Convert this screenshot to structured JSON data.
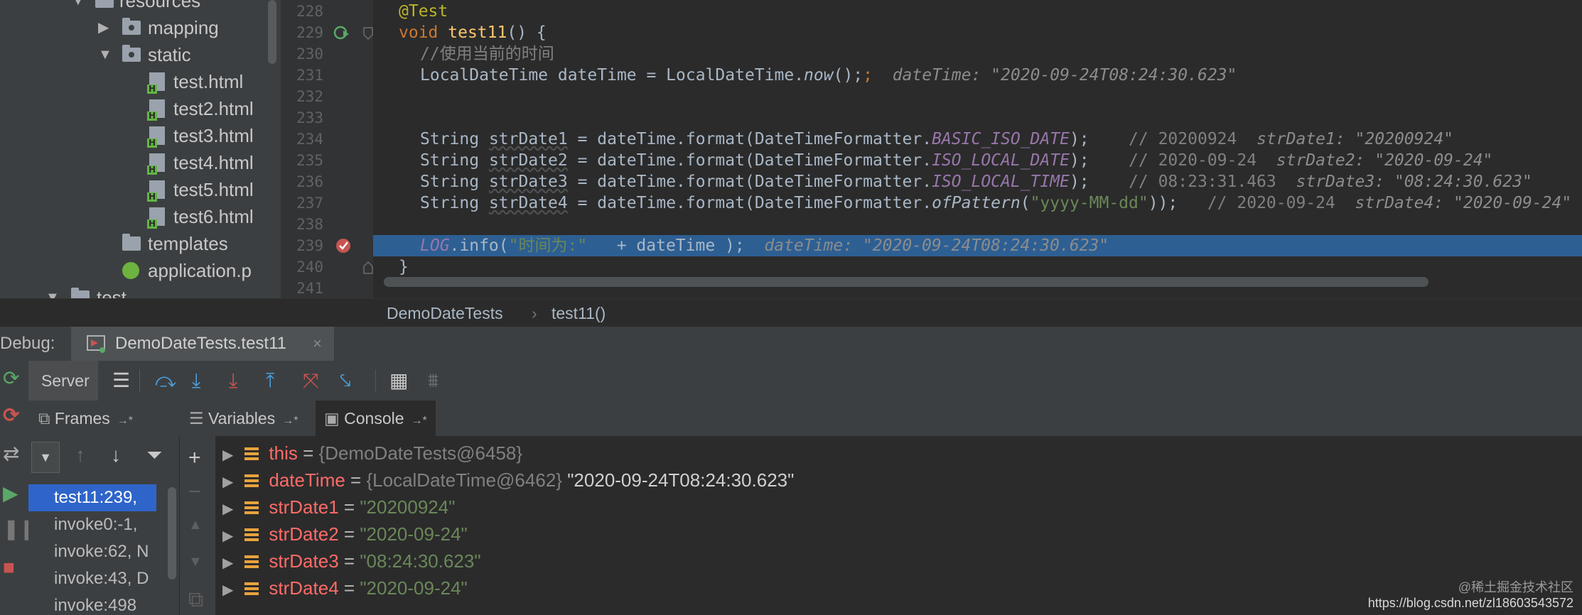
{
  "project_tree": {
    "items": [
      {
        "label": "resources",
        "icon": "folder-icon"
      },
      {
        "label": "mapping",
        "icon": "folder-icon"
      },
      {
        "label": "static",
        "icon": "folder-icon"
      },
      {
        "label": "test.html",
        "icon": "html-file-icon"
      },
      {
        "label": "test2.html",
        "icon": "html-file-icon"
      },
      {
        "label": "test3.html",
        "icon": "html-file-icon"
      },
      {
        "label": "test4.html",
        "icon": "html-file-icon"
      },
      {
        "label": "test5.html",
        "icon": "html-file-icon"
      },
      {
        "label": "test6.html",
        "icon": "html-file-icon"
      },
      {
        "label": "templates",
        "icon": "folder-icon"
      },
      {
        "label": "application.p",
        "icon": "spring-properties-icon"
      },
      {
        "label": "test",
        "icon": "folder-icon"
      }
    ]
  },
  "editor": {
    "line_numbers": [
      "228",
      "229",
      "230",
      "231",
      "232",
      "233",
      "234",
      "235",
      "236",
      "237",
      "238",
      "239",
      "240",
      "241"
    ],
    "code": {
      "l228": "@Test",
      "l229_kw": "void",
      "l229_fn": "test11",
      "l229_rest": "() {",
      "l230": "//使用当前的时间",
      "l231_code": "LocalDateTime dateTime = LocalDateTime.",
      "l231_now": "now",
      "l231_end": "();",
      "l231_inline": "dateTime: \"2020-09-24T08:24:30.623\"",
      "l234_a": "String ",
      "l234_var": "strDate1",
      "l234_b": " = dateTime.format(DateTimeFormatter.",
      "l234_const": "BASIC_ISO_DATE",
      "l234_c": ");",
      "l234_comment": "// 20200924",
      "l234_inline": "strDate1: \"20200924\"",
      "l235_a": "String ",
      "l235_var": "strDate2",
      "l235_b": " = dateTime.format(DateTimeFormatter.",
      "l235_const": "ISO_LOCAL_DATE",
      "l235_c": ");",
      "l235_comment": "// 2020-09-24",
      "l235_inline": "strDate2: \"2020-09-24\"",
      "l236_a": "String ",
      "l236_var": "strDate3",
      "l236_b": " = dateTime.format(DateTimeFormatter.",
      "l236_const": "ISO_LOCAL_TIME",
      "l236_c": ");",
      "l236_comment": "// 08:23:31.463",
      "l236_inline": "strDate3: \"08:24:30.623\"",
      "l237_a": "String ",
      "l237_var": "strDate4",
      "l237_b": " = dateTime.format(DateTimeFormatter.",
      "l237_fn": "ofPattern",
      "l237_p": "(",
      "l237_str": "\"yyyy-MM-dd\"",
      "l237_c": "));",
      "l237_comment": "// 2020-09-24",
      "l237_inline": "strDate4: \"2020-09-24\"",
      "l239_log": "LOG",
      "l239_a": ".info(",
      "l239_str": "\"时间为:\"",
      "l239_b": "   + dateTime );",
      "l239_inline": "dateTime: \"2020-09-24T08:24:30.623\"",
      "l240": "}"
    }
  },
  "breadcrumb": {
    "class": "DemoDateTests",
    "sep": "›",
    "method": "test11()"
  },
  "debug": {
    "label": "Debug:",
    "tab_title": "DemoDateTests.test11",
    "close": "×",
    "server_tab": "Server",
    "panel_tabs": {
      "frames": "Frames",
      "variables": "Variables",
      "console": "Console",
      "pin": "→*"
    },
    "frames": [
      "test11:239,",
      "invoke0:-1,",
      "invoke:62, N",
      "invoke:43, D",
      "invoke:498"
    ],
    "variables": [
      {
        "name": "this",
        "ref": "{DemoDateTests@6458}",
        "value": ""
      },
      {
        "name": "dateTime",
        "ref": "{LocalDateTime@6462}",
        "value": "\"2020-09-24T08:24:30.623\""
      },
      {
        "name": "strDate1",
        "ref": "",
        "value": "\"20200924\""
      },
      {
        "name": "strDate2",
        "ref": "",
        "value": "\"2020-09-24\""
      },
      {
        "name": "strDate3",
        "ref": "",
        "value": "\"08:24:30.623\""
      },
      {
        "name": "strDate4",
        "ref": "",
        "value": "\"2020-09-24\""
      }
    ],
    "equals": "="
  },
  "watermark": {
    "line1": "@稀土掘金技术社区",
    "line2": "https://blog.csdn.net/zl18603543572"
  },
  "colors": {
    "selection": "#2d5f93",
    "frame_selected": "#2f65ca",
    "var_name": "#ff6b68",
    "string": "#6a8759"
  }
}
